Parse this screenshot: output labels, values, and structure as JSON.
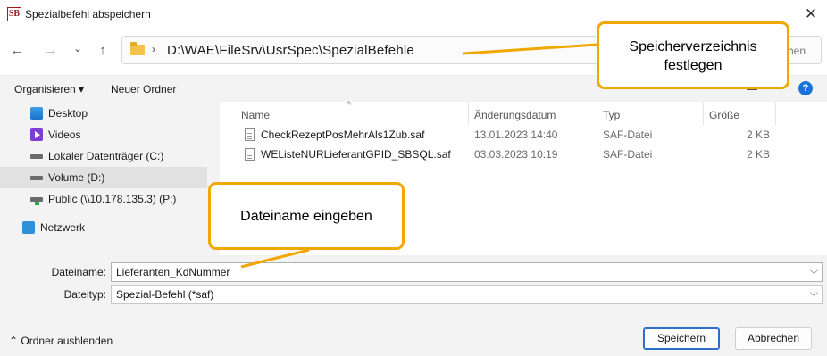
{
  "window": {
    "title": "Spezialbefehl abspeichern",
    "logo_text": "SB",
    "close_glyph": "✕"
  },
  "nav": {
    "back": "←",
    "forward": "→",
    "recent": "⌄",
    "up": "↑",
    "chevron": "›",
    "path": "D:\\WAE\\FileSrv\\UsrSpec\\SpezialBefehle",
    "search_placeholder_visible": "chen"
  },
  "toolbar": {
    "organize_label": "Organisieren ▾",
    "new_folder_label": "Neuer Ordner",
    "help_glyph": "?"
  },
  "sidebar": {
    "items": [
      {
        "label": "Desktop",
        "icon": "desktop-icon"
      },
      {
        "label": "Videos",
        "icon": "videos-icon"
      },
      {
        "label": "Lokaler Datenträger (C:)",
        "icon": "drive-icon"
      },
      {
        "label": "Volume (D:)",
        "icon": "drive-icon",
        "selected": true
      },
      {
        "label": "Public (\\\\10.178.135.3) (P:)",
        "icon": "network-drive-icon"
      },
      {
        "label": "Netzwerk",
        "icon": "network-icon"
      }
    ]
  },
  "filelist": {
    "columns": [
      "Name",
      "Änderungsdatum",
      "Typ",
      "Größe"
    ],
    "sort_glyph": "^",
    "rows": [
      {
        "name": "CheckRezeptPosMehrAls1Zub.saf",
        "date": "13.01.2023 14:40",
        "type": "SAF-Datei",
        "size": "2 KB"
      },
      {
        "name": "WEListeNURLieferantGPID_SBSQL.saf",
        "date": "03.03.2023 10:19",
        "type": "SAF-Datei",
        "size": "2 KB"
      }
    ]
  },
  "form": {
    "filename_label": "Dateiname:",
    "filename_value": "Lieferanten_KdNummer",
    "filetype_label": "Dateityp:",
    "filetype_value": "Spezial-Befehl (*saf)",
    "dropdown_glyph": "⌵"
  },
  "footer": {
    "hide_folders_label": "⌃  Ordner ausblenden",
    "save_label": "Speichern",
    "cancel_label": "Abbrechen"
  },
  "callouts": {
    "directory_line1": "Speicherverzeichnis",
    "directory_line2": "festlegen",
    "filename": "Dateiname eingeben"
  },
  "colors": {
    "callout_border": "#f0a800",
    "accent": "#2f6fc7",
    "panel_bg": "#f3f3f3"
  }
}
